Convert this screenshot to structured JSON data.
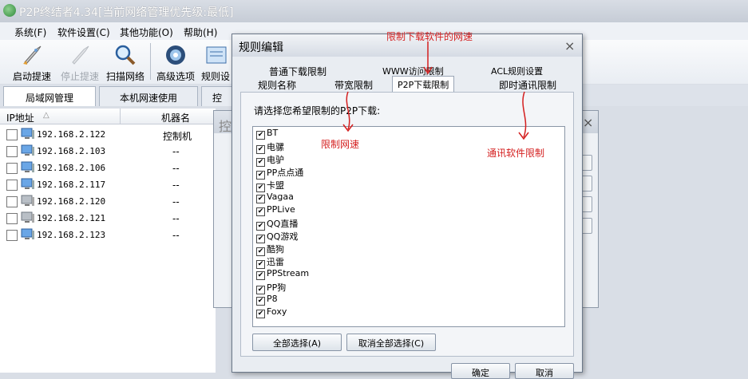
{
  "window": {
    "title": "P2P终结者4.34[当前网络管理优先级:最低]"
  },
  "menu": [
    "系统(F)",
    "软件设置(C)",
    "其他功能(O)",
    "帮助(H)"
  ],
  "toolbar": {
    "items": [
      "启动提速",
      "停止提速",
      "扫描网络",
      "高级选项",
      "规则设"
    ]
  },
  "main_tabs": [
    "局域网管理",
    "本机网速使用",
    "控"
  ],
  "list": {
    "headers": {
      "ip": "IP地址",
      "sort": "△",
      "machine": "机器名"
    },
    "rows": [
      {
        "ip": "192.168.2.122",
        "name": "控制机"
      },
      {
        "ip": "192.168.2.103",
        "name": "--"
      },
      {
        "ip": "192.168.2.106",
        "name": "--"
      },
      {
        "ip": "192.168.2.117",
        "name": "--"
      },
      {
        "ip": "192.168.2.120",
        "name": "--"
      },
      {
        "ip": "192.168.2.121",
        "name": "--"
      },
      {
        "ip": "192.168.2.123",
        "name": "--"
      }
    ]
  },
  "bg_dialog": {
    "title": "控",
    "close": "×"
  },
  "dialog": {
    "title": "规则编辑",
    "close": "×",
    "tabs_row1": [
      "普通下载限制",
      "WWW访问限制",
      "ACL规则设置"
    ],
    "tabs_row2": [
      "规则名称",
      "带宽限制",
      "P2P下载限制",
      "即时通讯限制"
    ],
    "prompt": "请选择您希望限制的P2P下载:",
    "items": [
      "BT",
      "电骡",
      "电驴",
      "PP点点通",
      "卡盟",
      "Vagaa",
      "PPLive",
      "QQ直播",
      "QQ游戏",
      "酷狗",
      "迅雷",
      "PPStream",
      "PP狗",
      "P8",
      "Foxy"
    ],
    "check_mark": "✔",
    "select_all": "全部选择(A)",
    "deselect_all": "取消全部选择(C)",
    "ok": "确定",
    "cancel": "取消"
  },
  "annotations": {
    "top": "限制下载软件的网速",
    "left": "限制网速",
    "right": "通讯软件限制",
    "color": "#d41f1f"
  }
}
